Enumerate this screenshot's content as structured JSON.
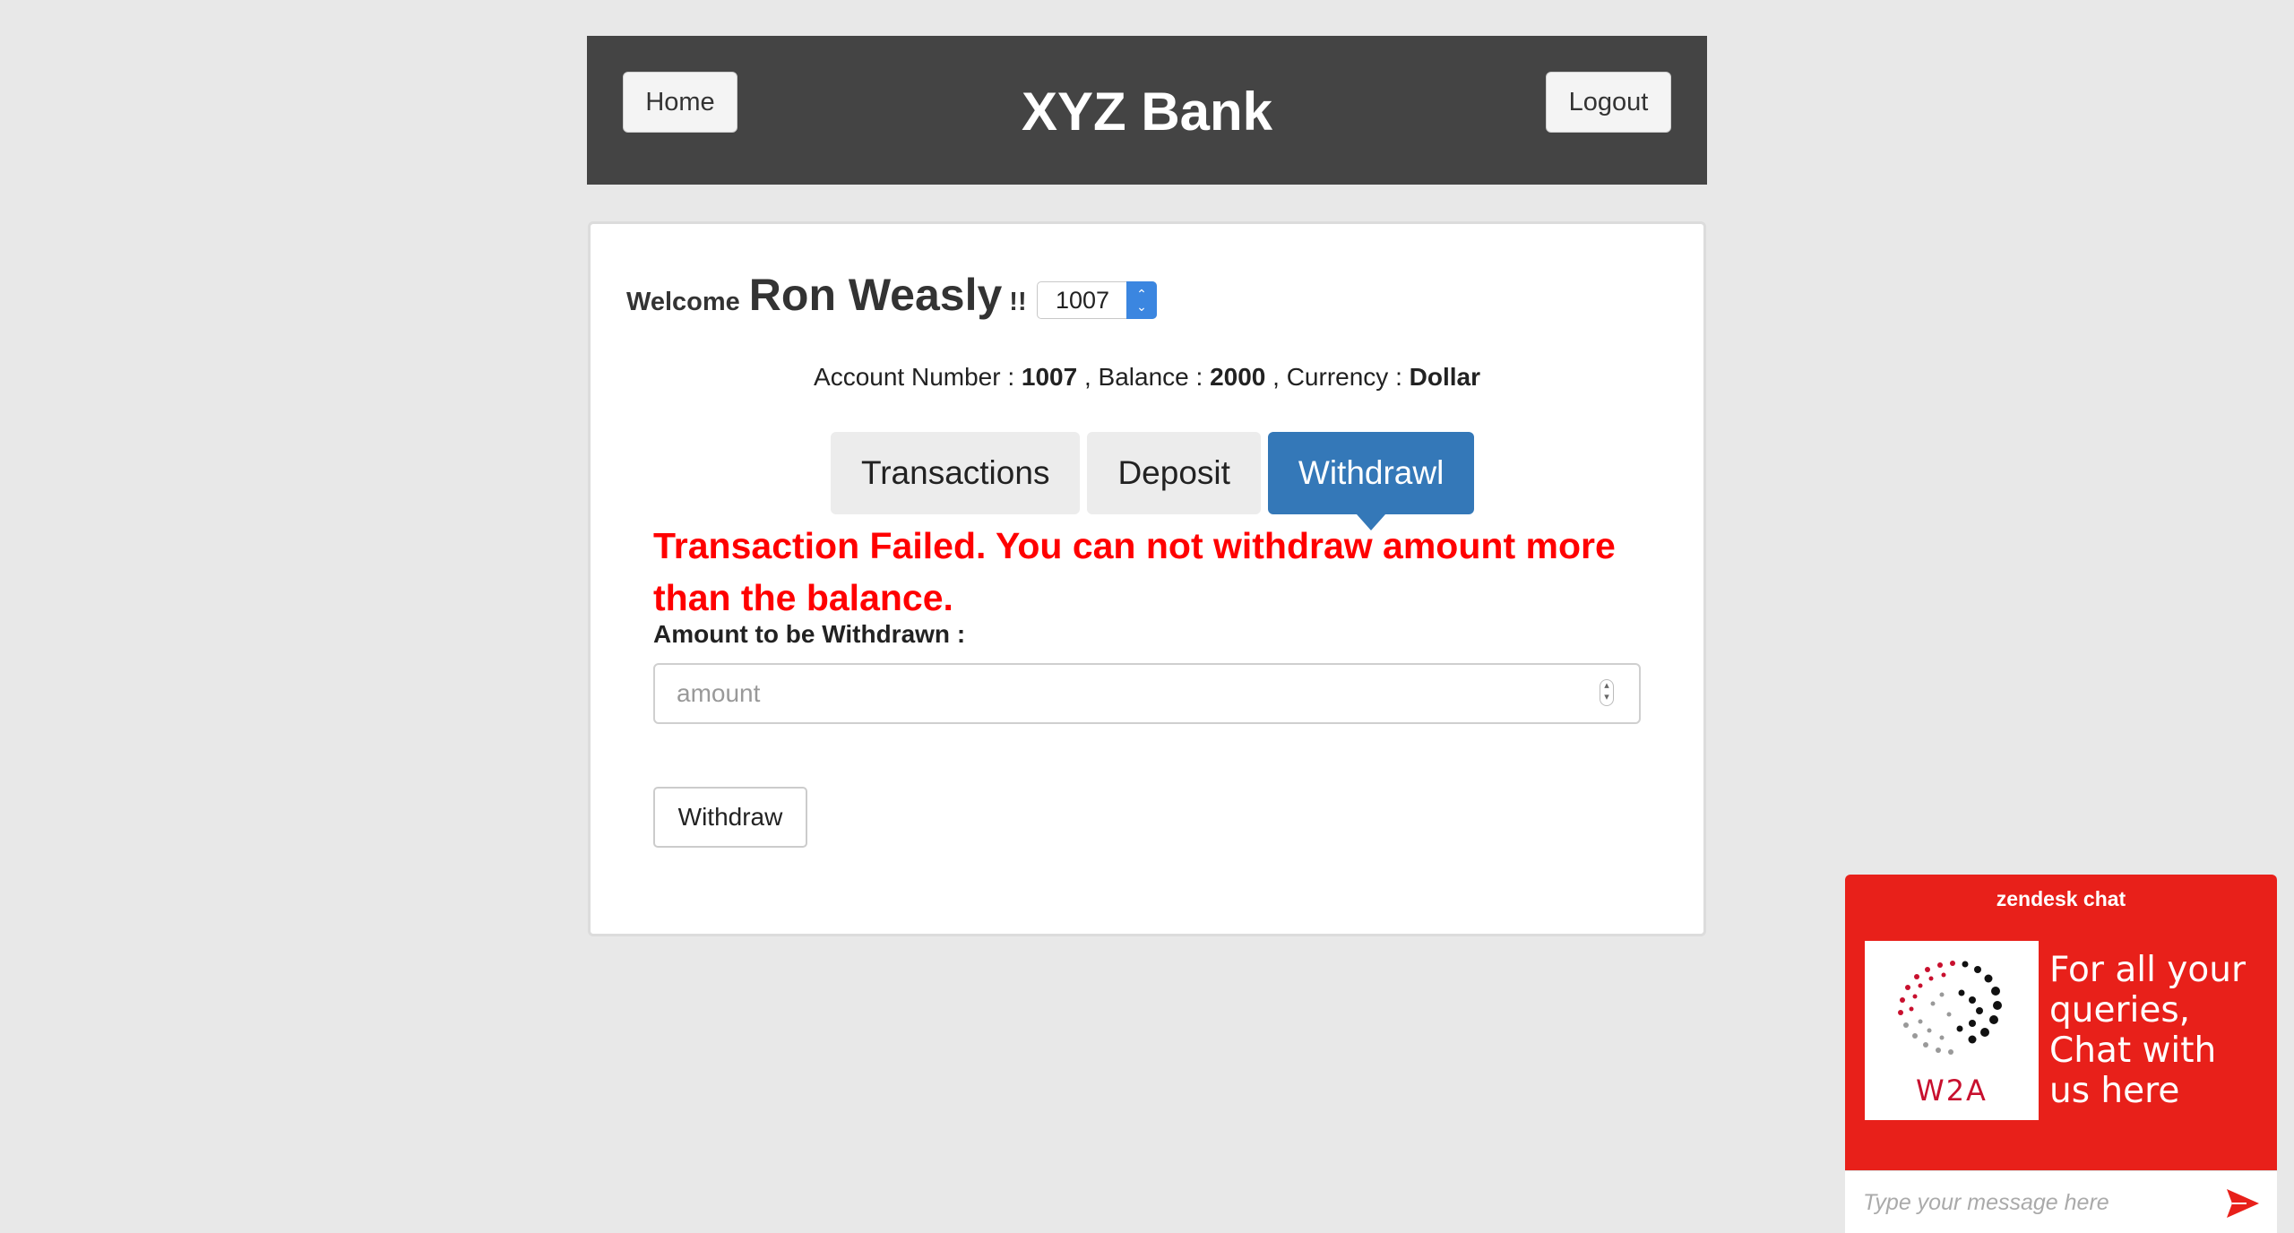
{
  "header": {
    "home_label": "Home",
    "title": "XYZ Bank",
    "logout_label": "Logout"
  },
  "welcome": {
    "prefix": "Welcome",
    "customer_name": "Ron Weasly",
    "suffix": "!!",
    "selected_account": "1007"
  },
  "account_info": {
    "account_label": "Account Number : ",
    "account_number": "1007",
    "balance_label": " , Balance : ",
    "balance": "2000",
    "currency_label": " , Currency : ",
    "currency": "Dollar"
  },
  "tabs": [
    {
      "label": "Transactions",
      "active": false
    },
    {
      "label": "Deposit",
      "active": false
    },
    {
      "label": "Withdrawl",
      "active": true
    }
  ],
  "withdraw_form": {
    "error_message": "Transaction Failed. You can not withdraw amount more than the balance.",
    "amount_label": "Amount to be Withdrawn :",
    "amount_placeholder": "amount",
    "amount_value": "",
    "submit_label": "Withdraw"
  },
  "chat_widget": {
    "title": "zendesk chat",
    "logo_text": "W2A",
    "promo_text": "For all your queries, Chat with us here",
    "input_placeholder": "Type your message here",
    "brand_color": "#e8201a"
  },
  "colors": {
    "header_bg": "#444444",
    "active_tab": "#3478b8",
    "error_text": "#ff0000"
  }
}
